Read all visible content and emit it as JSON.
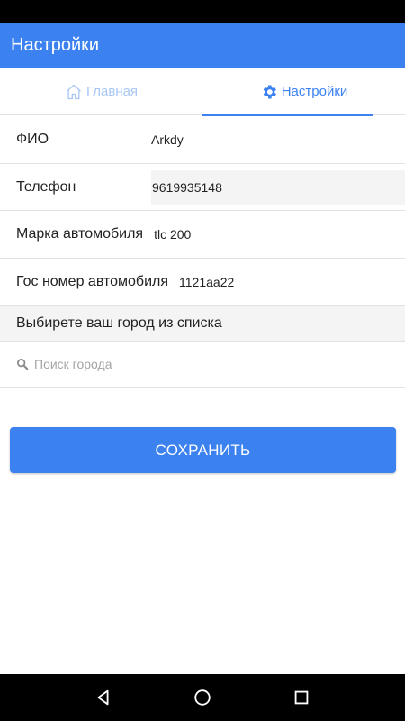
{
  "app_bar": {
    "title": "Настройки"
  },
  "tabs": [
    {
      "label": "Главная",
      "icon": "home-icon",
      "active": false
    },
    {
      "label": "Настройки",
      "icon": "gear-icon",
      "active": true
    }
  ],
  "form": {
    "fio": {
      "label": "ФИО",
      "value": "Arkdy"
    },
    "phone": {
      "label": "Телефон",
      "value": "9619935148"
    },
    "car_brand": {
      "label": "Марка автомобиля",
      "value": "tlc 200"
    },
    "plate": {
      "label": "Гос номер автомобиля",
      "value": "1121aa22"
    }
  },
  "city": {
    "header": "Выбирете ваш город из списка",
    "search_placeholder": "Поиск города",
    "search_value": ""
  },
  "save_button": {
    "label": "СОХРАНИТЬ"
  },
  "colors": {
    "accent": "#3b82f0",
    "inactive_tab": "#a9c7f5",
    "divider": "#e2e2e2",
    "section_bg": "#f4f4f4"
  },
  "nav": {
    "back": "back-icon",
    "home": "home-circle-icon",
    "recents": "recents-icon"
  }
}
